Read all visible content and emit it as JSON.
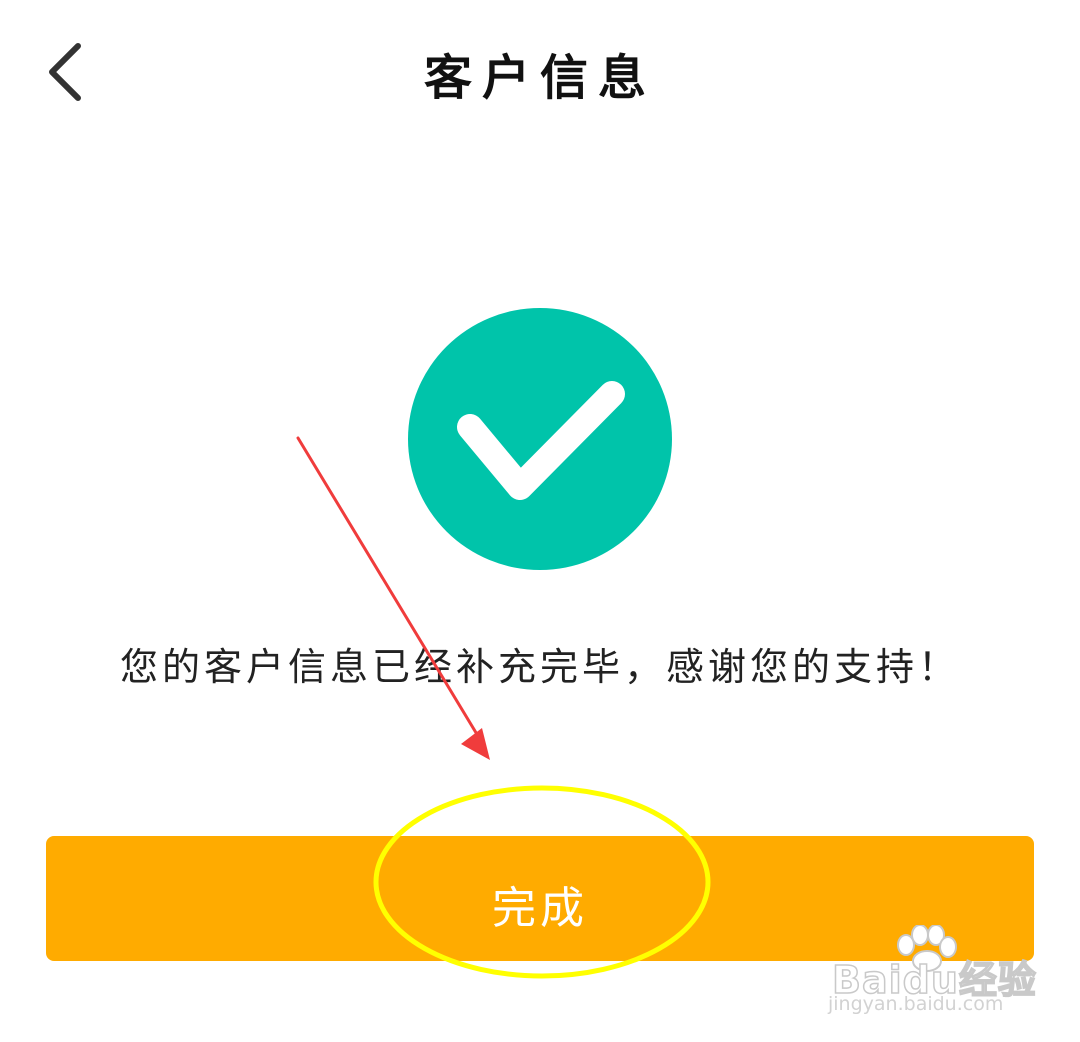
{
  "header": {
    "title": "客户信息",
    "back_icon": "chevron-left-icon"
  },
  "status": {
    "icon": "check-circle-icon",
    "icon_color": "#00c4aa",
    "message": "您的客户信息已经补充完毕，感谢您的支持！"
  },
  "actions": {
    "done_label": "完成",
    "done_color": "#ffab00"
  },
  "annotation": {
    "arrow_color": "#f03c3c",
    "highlight_color": "#ffff00"
  },
  "watermark": {
    "brand": "Baidu经验",
    "url": "jingyan.baidu.com"
  }
}
